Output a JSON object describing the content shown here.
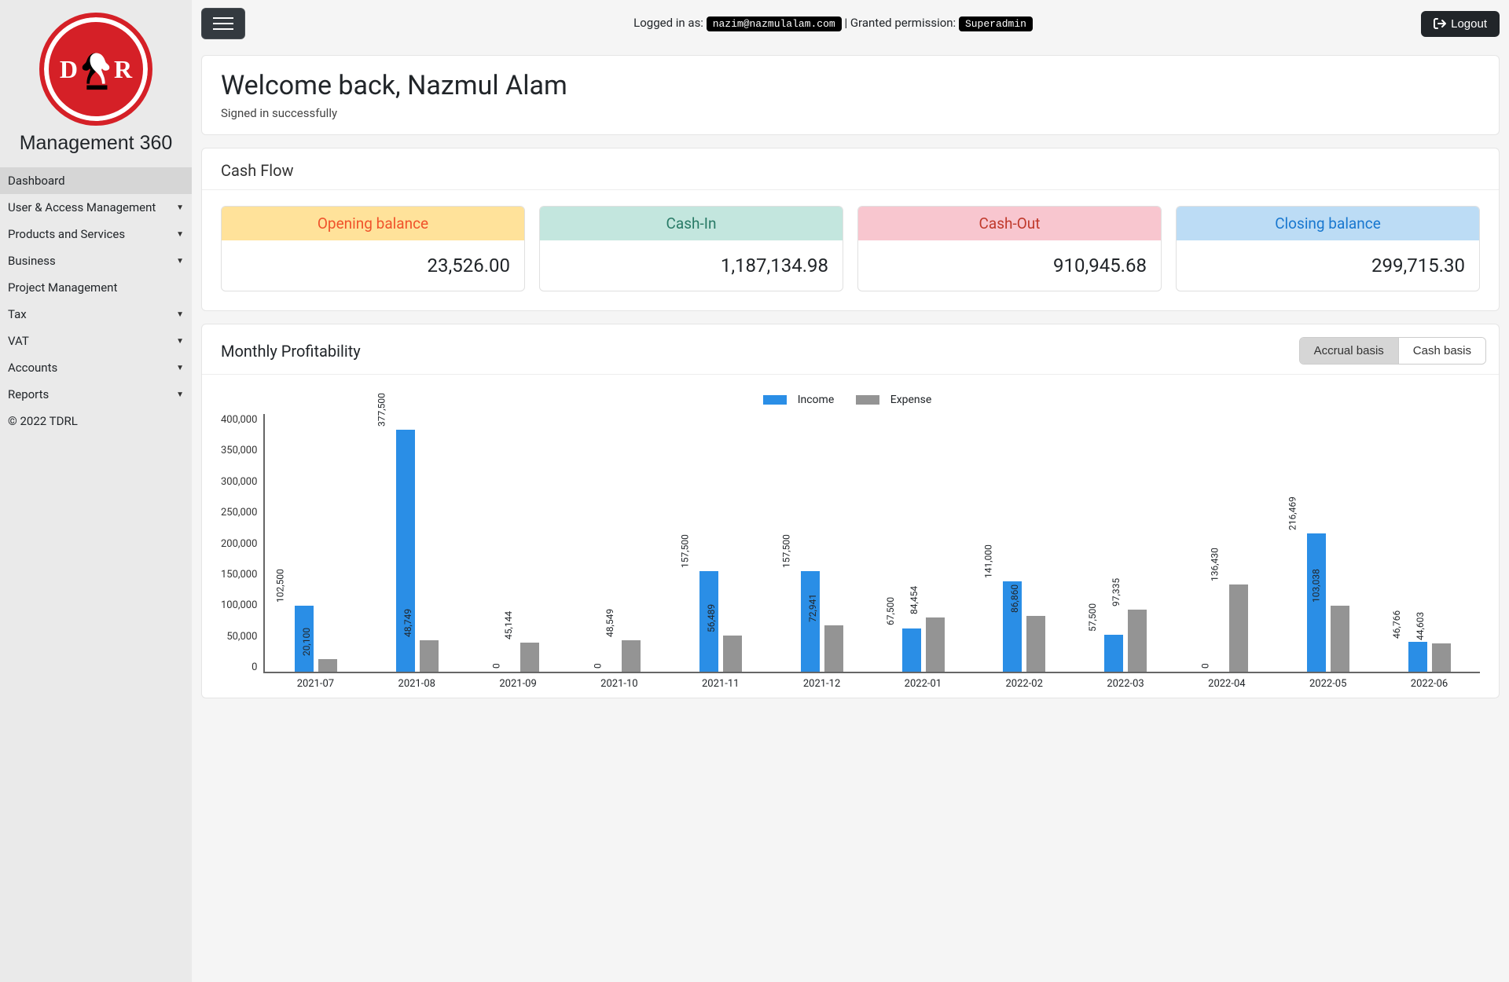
{
  "sidebar": {
    "brand": "Management 360",
    "items": [
      {
        "label": "Dashboard",
        "dropdown": false,
        "active": true
      },
      {
        "label": "User & Access Management",
        "dropdown": true
      },
      {
        "label": "Products and Services",
        "dropdown": true
      },
      {
        "label": "Business",
        "dropdown": true
      },
      {
        "label": "Project Management",
        "dropdown": false
      },
      {
        "label": "Tax",
        "dropdown": true
      },
      {
        "label": "VAT",
        "dropdown": true
      },
      {
        "label": "Accounts",
        "dropdown": true
      },
      {
        "label": "Reports",
        "dropdown": true
      }
    ],
    "copyright": "© 2022 TDRL"
  },
  "topbar": {
    "logged_in_label": "Logged in as:",
    "user_email": "nazim@nazmulalam.com",
    "permission_label": "| Granted permission:",
    "permission_value": "Superadmin",
    "logout_label": "Logout"
  },
  "welcome": {
    "title": "Welcome back, Nazmul Alam",
    "subtitle": "Signed in successfully"
  },
  "cashflow": {
    "title": "Cash Flow",
    "cards": [
      {
        "label": "Opening balance",
        "value": "23,526.00"
      },
      {
        "label": "Cash-In",
        "value": "1,187,134.98"
      },
      {
        "label": "Cash-Out",
        "value": "910,945.68"
      },
      {
        "label": "Closing balance",
        "value": "299,715.30"
      }
    ]
  },
  "profitability": {
    "title": "Monthly Profitability",
    "tabs": {
      "accrual": "Accrual basis",
      "cash": "Cash basis"
    },
    "legend": {
      "income": "Income",
      "expense": "Expense"
    }
  },
  "chart_data": {
    "type": "bar",
    "categories": [
      "2021-07",
      "2021-08",
      "2021-09",
      "2021-10",
      "2021-11",
      "2021-12",
      "2022-01",
      "2022-02",
      "2022-03",
      "2022-04",
      "2022-05",
      "2022-06"
    ],
    "series": [
      {
        "name": "Income",
        "values": [
          102500,
          377500,
          0,
          0,
          157500,
          157500,
          67500,
          141000,
          57500,
          0,
          216469,
          46766
        ]
      },
      {
        "name": "Expense",
        "values": [
          20100,
          48749,
          45144,
          48549,
          56489,
          72941,
          84454,
          86860,
          97335,
          136430,
          103038,
          44603
        ]
      }
    ],
    "ylabel": "",
    "xlabel": "",
    "ylim": [
      0,
      400000
    ],
    "yticks": [
      0,
      50000,
      100000,
      150000,
      200000,
      250000,
      300000,
      350000,
      400000
    ]
  }
}
